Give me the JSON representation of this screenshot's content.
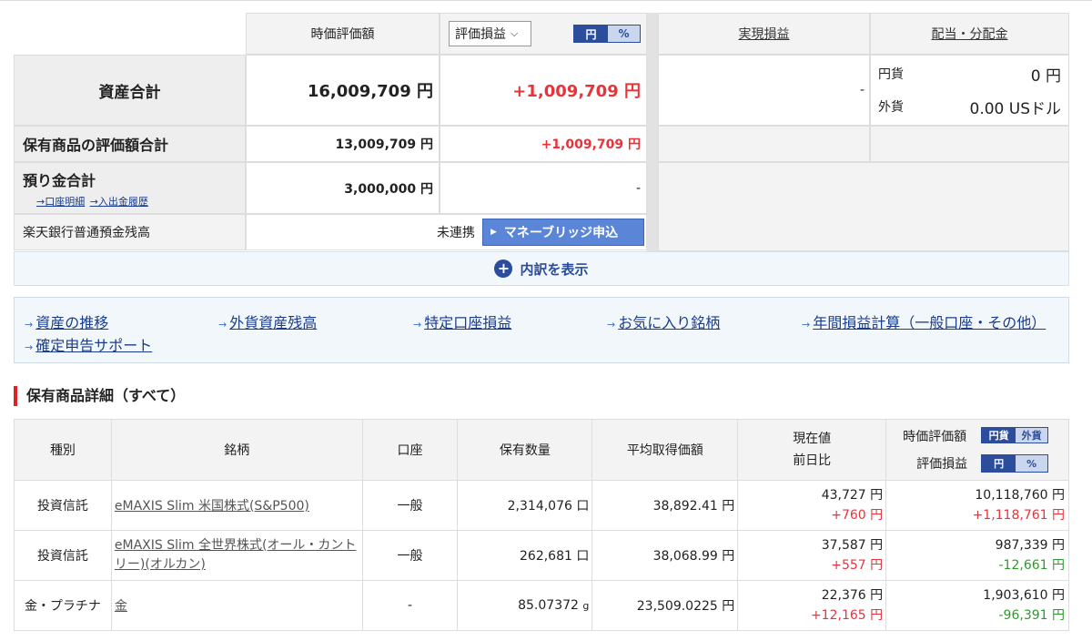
{
  "summary": {
    "header_market_value": "時価評価額",
    "pl_select": "評価損益",
    "unit_toggle": [
      "円",
      "%"
    ],
    "header_realized": "実現損益",
    "header_dividend": "配当・分配金",
    "total_assets_label": "資産合計",
    "total_assets_value": "16,009,709 円",
    "total_assets_pl": "+1,009,709 円",
    "realized_value": "-",
    "div_jpy_label": "円貨",
    "div_jpy_value": "0 円",
    "div_fx_label": "外貨",
    "div_fx_value": "0.00 USドル",
    "holdings_label": "保有商品の評価額合計",
    "holdings_value": "13,009,709 円",
    "holdings_pl": "+1,009,709 円",
    "deposit_label": "預り金合計",
    "deposit_link1": "→口座明細",
    "deposit_link2": "→入出金履歴",
    "deposit_value": "3,000,000 円",
    "deposit_pl": "-",
    "bank_label": "楽天銀行普通預金残高",
    "bank_status": "未連携",
    "bank_button": "マネーブリッジ申込",
    "breakdown_label": "内訳を表示"
  },
  "links": [
    "資産の推移",
    "外貨資産残高",
    "特定口座損益",
    "お気に入り銘柄",
    "年間損益計算（一般口座・その他）",
    "確定申告サポート"
  ],
  "section_title": "保有商品詳細（すべて）",
  "table": {
    "headers": {
      "type": "種別",
      "name": "銘柄",
      "account": "口座",
      "qty": "保有数量",
      "avg": "平均取得価額",
      "price1": "現在値",
      "price2": "前日比",
      "mv": "時価評価額",
      "pl": "評価損益",
      "ccy_toggle": [
        "円貨",
        "外貨"
      ],
      "pl_toggle": [
        "円",
        "%"
      ]
    },
    "rows": [
      {
        "type": "投資信託",
        "name": "eMAXIS Slim 米国株式(S&P500)",
        "account": "一般",
        "qty": "2,314,076",
        "qty_unit": "口",
        "avg": "38,892.41 円",
        "price": "43,727 円",
        "change": "+760 円",
        "mv": "10,118,760 円",
        "pl": "+1,118,761 円",
        "pl_sign": "pos"
      },
      {
        "type": "投資信託",
        "name": "eMAXIS Slim 全世界株式(オール・カントリー)(オルカン)",
        "account": "一般",
        "qty": "262,681",
        "qty_unit": "口",
        "avg": "38,068.99 円",
        "price": "37,587 円",
        "change": "+557 円",
        "mv": "987,339 円",
        "pl": "-12,661 円",
        "pl_sign": "neg"
      },
      {
        "type": "金・プラチナ",
        "name": "金",
        "account": "-",
        "qty": "85.07372",
        "qty_unit": "g",
        "avg": "23,509.0225 円",
        "price": "22,376 円",
        "change": "+12,165 円",
        "mv": "1,903,610 円",
        "pl": "-96,391 円",
        "pl_sign": "neg"
      }
    ]
  },
  "colors": {
    "positive": "#e8333a",
    "negative": "#2e9a2e",
    "accent": "#2b4d9c"
  }
}
